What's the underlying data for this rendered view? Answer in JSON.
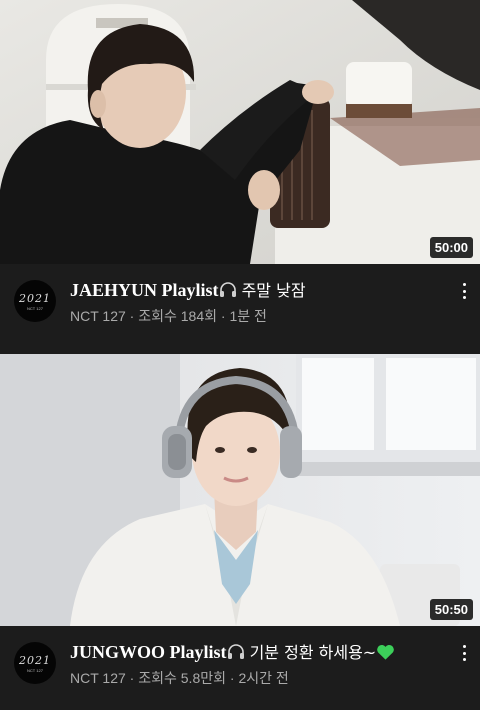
{
  "videos": [
    {
      "title_main": "JAEHYUN Playlist",
      "title_suffix": " 주말 낮잠",
      "headphone_icon": "headphone-icon",
      "duration": "50:00",
      "channel": "NCT 127",
      "views": "조회수 184회",
      "age": "1분 전",
      "avatar_text": "2021",
      "avatar_sub": "NCT 127"
    },
    {
      "title_main": "JUNGWOO Playlist",
      "title_suffix": " 기분 정환 하세용~",
      "headphone_icon": "headphone-icon",
      "end_icon": "green-heart-icon",
      "duration": "50:50",
      "channel": "NCT 127",
      "views": "조회수 5.8만회",
      "age": "2시간 전",
      "avatar_text": "2021",
      "avatar_sub": "NCT 127"
    }
  ],
  "separator": " · ",
  "colors": {
    "background": "#1c1c1c",
    "meta_text": "#aaaaaa",
    "heart": "#3ccf5a"
  }
}
